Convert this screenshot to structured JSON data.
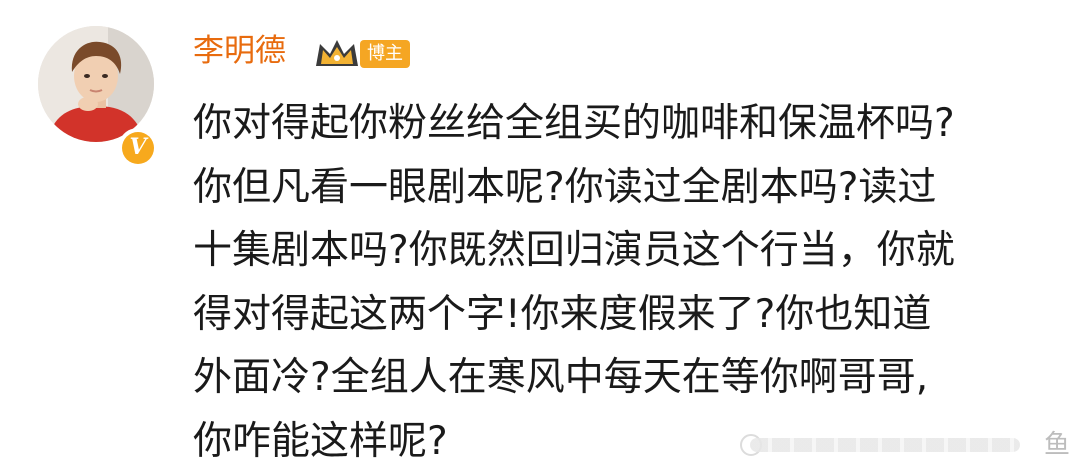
{
  "post": {
    "author": {
      "name": "李明德",
      "badge_label": "博主",
      "verified_mark": "V",
      "avatar_icon": "profile-photo",
      "crown_icon": "crown-icon",
      "name_color": "#e86b0e",
      "badge_color": "#f5a623",
      "verified_color": "#f7a91d"
    },
    "content_lines": [
      "你对得起你粉丝给全组买的咖啡和保温杯吗?",
      "你但凡看一眼剧本呢?你读过全剧本吗?读过",
      "十集剧本吗?你既然回归演员这个行当，你就",
      "得对得起这两个字!你来度假来了?你也知道",
      "外面冷?全组人在寒风中每天在等你啊哥哥,",
      "你咋能这样呢?"
    ],
    "watermark": {
      "text": "鱼"
    }
  }
}
